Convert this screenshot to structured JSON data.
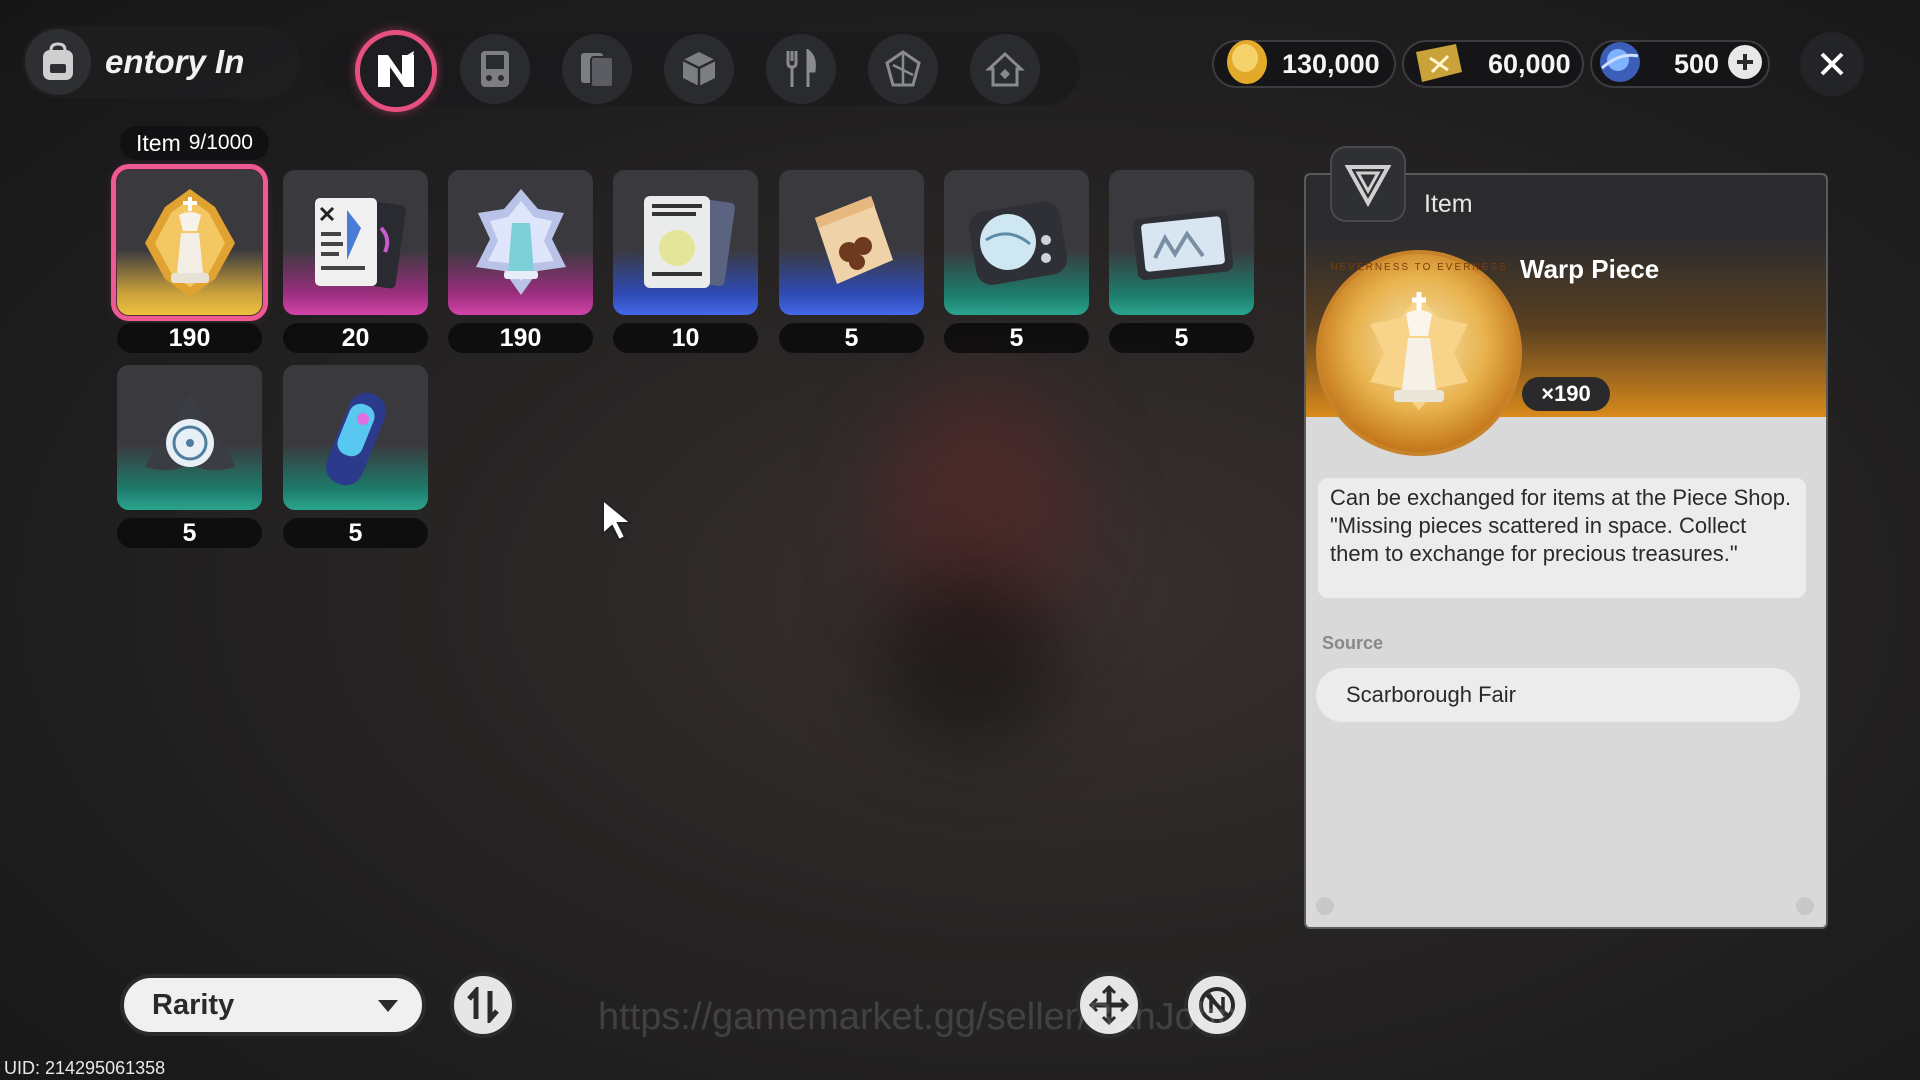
{
  "header": {
    "title_text": "entory In",
    "tabs": [
      {
        "name": "tab-item",
        "icon": "n-logo-icon",
        "active": true
      },
      {
        "name": "tab-gadget",
        "icon": "gameboy-icon"
      },
      {
        "name": "tab-cards",
        "icon": "cards-icon"
      },
      {
        "name": "tab-box",
        "icon": "cube-icon"
      },
      {
        "name": "tab-food",
        "icon": "fork-knife-icon"
      },
      {
        "name": "tab-material",
        "icon": "crystal-icon"
      },
      {
        "name": "tab-home",
        "icon": "house-icon"
      }
    ]
  },
  "currencies": [
    {
      "icon": "gold-coin-icon",
      "value": "130,000"
    },
    {
      "icon": "ticket-icon",
      "value": "60,000"
    },
    {
      "icon": "blue-orb-icon",
      "value": "500"
    }
  ],
  "inventory": {
    "label": "Item",
    "count": "9/1000",
    "items": [
      {
        "name": "Warp Piece",
        "qty": "190",
        "rarity": "gold",
        "selected": true
      },
      {
        "name": "item-2",
        "qty": "20",
        "rarity": "pink"
      },
      {
        "name": "item-3",
        "qty": "190",
        "rarity": "pink"
      },
      {
        "name": "item-4",
        "qty": "10",
        "rarity": "blue"
      },
      {
        "name": "item-5",
        "qty": "5",
        "rarity": "blue"
      },
      {
        "name": "item-6",
        "qty": "5",
        "rarity": "teal"
      },
      {
        "name": "item-7",
        "qty": "5",
        "rarity": "teal"
      },
      {
        "name": "item-8",
        "qty": "5",
        "rarity": "teal"
      },
      {
        "name": "item-9",
        "qty": "5",
        "rarity": "teal"
      }
    ]
  },
  "detail": {
    "category": "Item",
    "name": "Warp Piece",
    "quantity": "×190",
    "description_1": "Can be exchanged for items at the Piece Shop.",
    "description_2": "\"Missing pieces scattered in space. Collect them to exchange for precious treasures.\"",
    "medal_text": "NEVERNESS TO EVERNESS",
    "source_label": "Source",
    "source": "Scarborough Fair"
  },
  "footer": {
    "sort_label": "Rarity",
    "watermark": "https://gamemarket.gg/seller/BanJohn",
    "uid": "UID: 214295061358"
  },
  "colors": {
    "accent": "#f05a92",
    "gold": "#f0c040",
    "pink": "#d244a8",
    "blue": "#4468e8",
    "teal": "#2aa58e"
  }
}
